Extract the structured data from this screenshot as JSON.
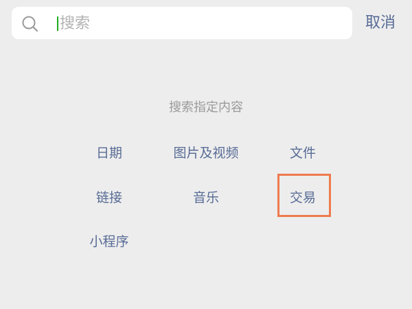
{
  "search": {
    "placeholder": "搜索",
    "value": "",
    "cancel_label": "取消"
  },
  "hint": {
    "title": "搜索指定内容"
  },
  "options": [
    {
      "label": "日期"
    },
    {
      "label": "图片及视频"
    },
    {
      "label": "文件"
    },
    {
      "label": "链接"
    },
    {
      "label": "音乐"
    },
    {
      "label": "交易",
      "highlighted": true
    },
    {
      "label": "小程序"
    }
  ],
  "colors": {
    "background": "#ededed",
    "link": "#576b95",
    "hint_text": "#9a9a9a",
    "caret": "#1aad19",
    "highlight_border": "#ee7a4d"
  },
  "icons": {
    "search": "search-icon"
  }
}
